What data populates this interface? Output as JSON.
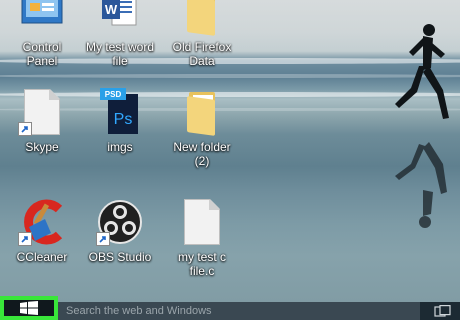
{
  "desktop": {
    "icons": [
      {
        "label": "Control\nPanel"
      },
      {
        "label": "My test word\nfile"
      },
      {
        "label": "Old Firefox\nData"
      },
      {
        "label": "Skype"
      },
      {
        "label": "imgs"
      },
      {
        "label": "New folder\n(2)"
      },
      {
        "label": "CCleaner"
      },
      {
        "label": "OBS Studio"
      },
      {
        "label": "my test c\nfile.c"
      }
    ]
  },
  "taskbar": {
    "search_placeholder": "Search the web and Windows"
  },
  "colors": {
    "highlight": "#39e63a",
    "taskbar": "#1c2a33"
  }
}
